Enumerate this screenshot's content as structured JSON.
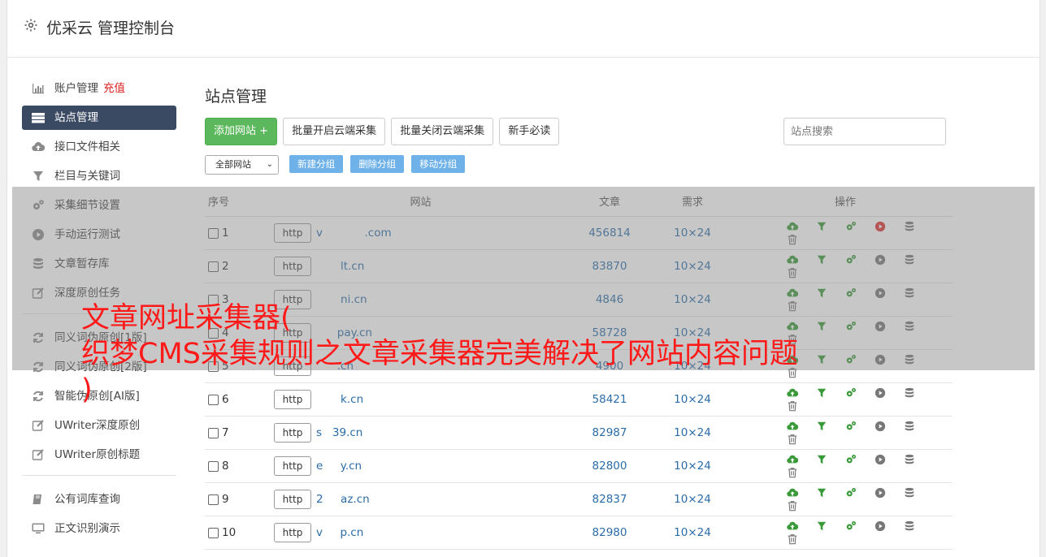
{
  "header": {
    "title": "优采云 管理控制台",
    "icon": "gear-icon"
  },
  "sidebar": {
    "group1": [
      {
        "label": "账户管理",
        "extra": "充值",
        "icon": "bar-chart-icon"
      },
      {
        "label": "站点管理",
        "icon": "server-icon",
        "active": true
      },
      {
        "label": "接口文件相关",
        "icon": "cloud-upload-icon"
      },
      {
        "label": "栏目与关键词",
        "icon": "filter-icon"
      },
      {
        "label": "采集细节设置",
        "icon": "gears-icon"
      },
      {
        "label": "手动运行测试",
        "icon": "play-circle-icon"
      },
      {
        "label": "文章暂存库",
        "icon": "database-icon"
      },
      {
        "label": "深度原创任务",
        "icon": "edit-icon"
      }
    ],
    "group2": [
      {
        "label": "同义词伪原创[1版]",
        "icon": "refresh-icon"
      },
      {
        "label": "同义词伪原创[2版]",
        "icon": "refresh-icon"
      },
      {
        "label": "智能伪原创[AI版]",
        "icon": "refresh-icon"
      },
      {
        "label": "UWriter深度原创",
        "icon": "edit-icon"
      },
      {
        "label": "UWriter原创标题",
        "icon": "edit-icon"
      }
    ],
    "group3": [
      {
        "label": "公有词库查询",
        "icon": "book-icon"
      },
      {
        "label": "正文识别演示",
        "icon": "monitor-icon"
      }
    ]
  },
  "main": {
    "title": "站点管理",
    "buttons": {
      "add": "添加网站 +",
      "batch_open": "批量开启云端采集",
      "batch_close": "批量关闭云端采集",
      "guide": "新手必读"
    },
    "search_placeholder": "站点搜索",
    "group_select": "全部网站",
    "group_buttons": {
      "new": "新建分组",
      "delete": "删除分组",
      "move": "移动分组"
    },
    "table": {
      "headers": {
        "no": "序号",
        "site": "网站",
        "articles": "文章",
        "demand": "需求",
        "ops": "操作"
      },
      "rows": [
        {
          "no": "1",
          "protocol": "http",
          "domain": "v            .com",
          "articles": "456814",
          "demand": "10×24",
          "running": true
        },
        {
          "no": "2",
          "protocol": "http",
          "domain": "       lt.cn",
          "articles": "83870",
          "demand": "10×24"
        },
        {
          "no": "3",
          "protocol": "http",
          "domain": "       ni.cn",
          "articles": "4846",
          "demand": "10×24"
        },
        {
          "no": "4",
          "protocol": "http",
          "domain": "      pay.cn",
          "articles": "58728",
          "demand": "10×24"
        },
        {
          "no": "5",
          "protocol": "http",
          "domain": "      .cn",
          "articles": "4900",
          "demand": "10×24"
        },
        {
          "no": "6",
          "protocol": "http",
          "domain": "       k.cn",
          "articles": "58421",
          "demand": "10×24"
        },
        {
          "no": "7",
          "protocol": "http",
          "domain": "s   39.cn",
          "articles": "82987",
          "demand": "10×24"
        },
        {
          "no": "8",
          "protocol": "http",
          "domain": "e     y.cn",
          "articles": "82800",
          "demand": "10×24"
        },
        {
          "no": "9",
          "protocol": "http",
          "domain": "2     az.cn",
          "articles": "82837",
          "demand": "10×24"
        },
        {
          "no": "10",
          "protocol": "http",
          "domain": "v     p.cn",
          "articles": "82980",
          "demand": "10×24"
        }
      ]
    }
  },
  "banner": {
    "text": "文章网址采集器(\n织梦CMS采集规则之文章采集器完美解决了网站内容问题\n)"
  },
  "colors": {
    "active_nav": "#3b4a63",
    "green": "#5cb85c",
    "blue_btn": "#6fb2ea",
    "link": "#2a6ca8",
    "banner": "#ff1a1a",
    "play_running": "#e03030"
  }
}
